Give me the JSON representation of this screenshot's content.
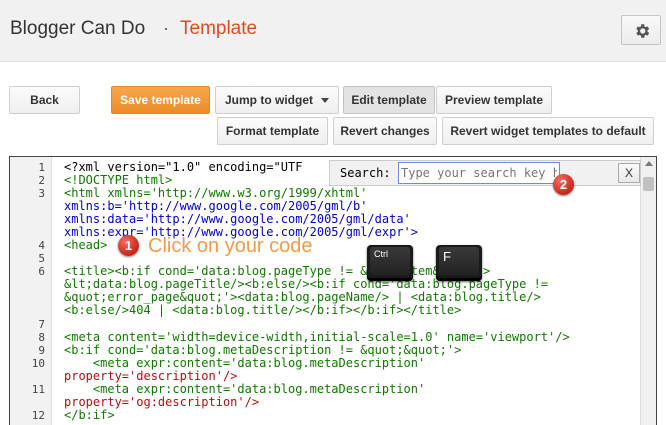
{
  "header": {
    "blog_title": "Blogger Can Do",
    "separator": "·",
    "page_title": "Template",
    "settings_icon": "gear-icon"
  },
  "toolbar": {
    "back": "Back",
    "save_template": "Save template",
    "jump_to_widget": "Jump to widget",
    "edit_template": "Edit template",
    "preview_template": "Preview template",
    "format_template": "Format template",
    "revert_changes": "Revert changes",
    "revert_widget_templates": "Revert widget templates to default"
  },
  "colors": {
    "accent": "#dd4b22",
    "save_button": "#f09a3e",
    "annotation_badge": "#d9342b",
    "annotation_text": "#f39a48"
  },
  "search": {
    "label": "Search:",
    "placeholder": "Type your search key here",
    "close": "X"
  },
  "annotations": {
    "step1_number": "1",
    "step1_text": "Click on your code",
    "step2_number": "2",
    "key_ctrl": "Ctrl",
    "key_f": "F"
  },
  "editor": {
    "line_numbers": [
      "1",
      "2",
      "3",
      "",
      "",
      "",
      "4",
      "",
      "5",
      "6",
      "",
      "",
      "",
      "7",
      "8",
      "9",
      "10",
      "",
      "11",
      "",
      "12"
    ],
    "lines": [
      "<?xml version=\"1.0\" encoding=\"UTF",
      "<!DOCTYPE html>",
      "<html xmlns='http://www.w3.org/1999/xhtml'",
      "xmlns:b='http://www.google.com/2005/gml/b'",
      "xmlns:data='http://www.google.com/2005/gml/data'",
      "xmlns:expr='http://www.google.com/2005/gml/expr'>",
      "<head>",
      "",
      "<title><b:if cond='data:blog.pageType != &quot;item&quot;'>",
      "&lt;data:blog.pageTitle/><b:else/><b:if cond='data:blog.pageType !=",
      "&quot;error_page&quot;'><data:blog.pageName/> | <data:blog.title/>",
      "<b:else/>404 | <data:blog.title/></b:if></b:if></title>",
      "",
      "<meta content='width=device-width,initial-scale=1.0' name='viewport'/>",
      "<b:if cond='data:blog.metaDescription != &quot;&quot;'>",
      "    <meta expr:content='data:blog.metaDescription'",
      "property='description'/>",
      "    <meta expr:content='data:blog.metaDescription'",
      "property='og:description'/>",
      "</b:if>"
    ]
  }
}
